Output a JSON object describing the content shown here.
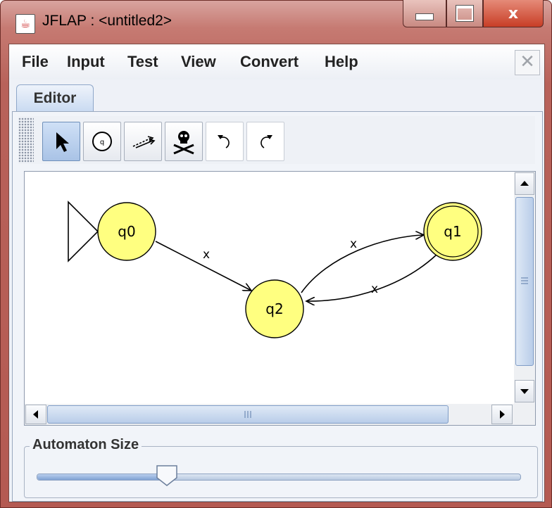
{
  "window": {
    "title": "JFLAP : <untitled2>",
    "close_glyph": "x"
  },
  "menu": {
    "items": [
      "File",
      "Input",
      "Test",
      "View",
      "Convert",
      "Help"
    ],
    "close_glyph": "✕"
  },
  "tabs": [
    {
      "label": "Editor",
      "selected": true
    }
  ],
  "toolbar": {
    "tools": [
      {
        "name": "attribute-editor",
        "icon": "arrow-cursor-icon",
        "selected": true
      },
      {
        "name": "state-creator",
        "icon": "state-circle-icon"
      },
      {
        "name": "transition-creator",
        "icon": "transition-arrow-icon"
      },
      {
        "name": "deleter",
        "icon": "skull-crossbones-icon"
      },
      {
        "name": "undo",
        "icon": "undo-icon"
      },
      {
        "name": "redo",
        "icon": "redo-icon"
      }
    ]
  },
  "automaton": {
    "states": [
      {
        "id": "q0",
        "label": "q0",
        "initial": true,
        "final": false
      },
      {
        "id": "q1",
        "label": "q1",
        "initial": false,
        "final": true
      },
      {
        "id": "q2",
        "label": "q2",
        "initial": false,
        "final": false
      }
    ],
    "transitions": [
      {
        "from": "q0",
        "to": "q2",
        "label": "x"
      },
      {
        "from": "q2",
        "to": "q1",
        "label": "x"
      },
      {
        "from": "q1",
        "to": "q2",
        "label": "x"
      }
    ],
    "state_color": "#ffff80"
  },
  "automaton_size": {
    "label": "Automaton Size",
    "value": 0.27
  },
  "colors": {
    "title_bar": "#c67a72",
    "selection": "#a9c3e6"
  }
}
